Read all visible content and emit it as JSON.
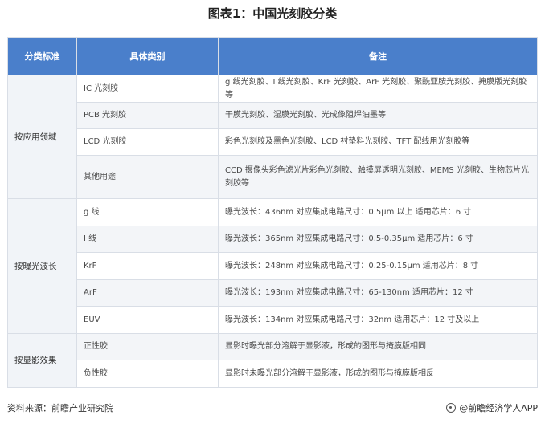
{
  "title": "图表1：中国光刻胶分类",
  "headers": [
    "分类标准",
    "具体类别",
    "备注"
  ],
  "groups": [
    {
      "name": "按应用领域",
      "rows": [
        {
          "sub": "IC 光刻胶",
          "note": "g 线光刻胶、I 线光刻胶、KrF 光刻胶、ArF 光刻胶、聚酰亚胺光刻胶、掩膜版光刻胶等"
        },
        {
          "sub": "PCB 光刻胶",
          "note": "干膜光刻胶、湿膜光刻胶、光成像阻焊油墨等"
        },
        {
          "sub": "LCD 光刻胶",
          "note": "彩色光刻胶及黑色光刻胶、LCD 衬垫料光刻胶、TFT 配线用光刻胶等"
        },
        {
          "sub": "其他用途",
          "note": "CCD 摄像头彩色滤光片彩色光刻胶、触摸屏透明光刻胶、MEMS 光刻胶、生物芯片光刻胶等"
        }
      ]
    },
    {
      "name": "按曝光波长",
      "rows": [
        {
          "sub": "g 线",
          "note": "曝光波长：436nm 对应集成电路尺寸：0.5μm 以上 适用芯片：6 寸"
        },
        {
          "sub": "I 线",
          "note": "曝光波长：365nm 对应集成电路尺寸：0.5-0.35μm 适用芯片：6 寸"
        },
        {
          "sub": "KrF",
          "note": "曝光波长：248nm 对应集成电路尺寸：0.25-0.15μm 适用芯片：8 寸"
        },
        {
          "sub": "ArF",
          "note": "曝光波长：193nm 对应集成电路尺寸：65-130nm 适用芯片：12 寸"
        },
        {
          "sub": "EUV",
          "note": "曝光波长：134nm 对应集成电路尺寸：32nm 适用芯片：12 寸及以上"
        }
      ]
    },
    {
      "name": "按显影效果",
      "rows": [
        {
          "sub": "正性胶",
          "note": "显影时曝光部分溶解于显影液，形成的图形与掩膜版相同"
        },
        {
          "sub": "负性胶",
          "note": "显影时未曝光部分溶解于显影液，形成的图形与掩膜版相反"
        }
      ]
    }
  ],
  "footer": {
    "source": "资料来源：前瞻产业研究院",
    "brand": "@前瞻经济学人APP"
  }
}
